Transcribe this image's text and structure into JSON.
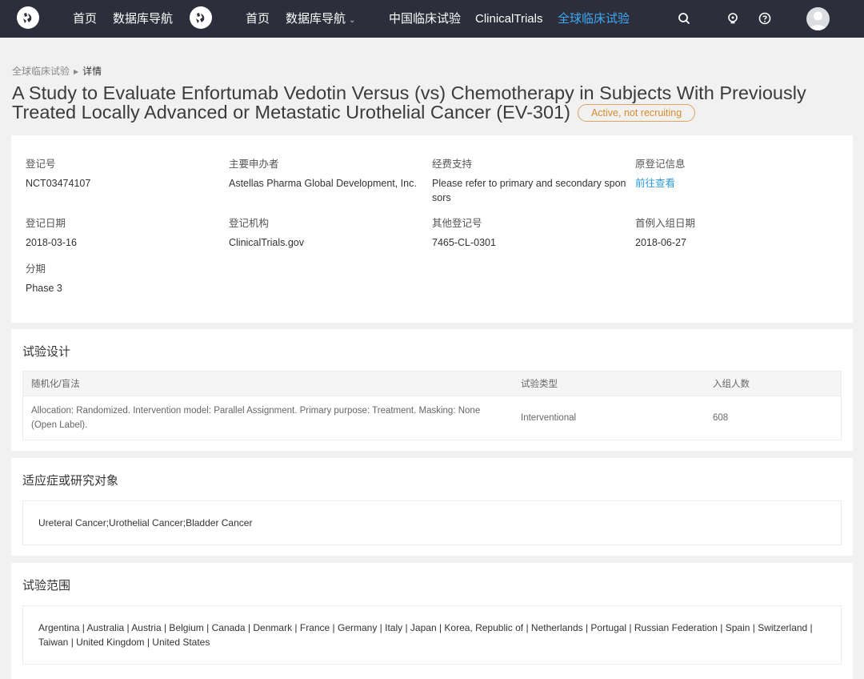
{
  "nav": {
    "home_1": "首页",
    "db_nav_1": "数据库导航",
    "home_2": "首页",
    "db_nav_2": "数据库导航",
    "cn_trials": "中国临床试验",
    "clinicaltrials": "ClinicalTrials",
    "global_trials": "全球临床试验",
    "icons": [
      "search-icon",
      "lightbulb-icon",
      "help-icon",
      "user-avatar"
    ],
    "accent_color": "#3fa9f5",
    "bg_color": "#2c2f3b"
  },
  "breadcrumb": {
    "parent": "全球临床试验",
    "current": "详情"
  },
  "trial": {
    "title": "A Study to Evaluate Enfortumab Vedotin Versus (vs) Chemotherapy in Subjects With Previously Treated Locally Advanced or Metastatic Urothelial Cancer (EV-301)",
    "status": "Active, not recruiting",
    "status_color": "#d88b2c"
  },
  "info": {
    "reg_no_label": "登记号",
    "reg_no": "NCT03474107",
    "sponsor_label": "主要申办者",
    "sponsor": "Astellas Pharma Global Development, Inc.",
    "funding_label": "经费支持",
    "funding": "Please refer to primary and secondary sponsors",
    "orig_label": "原登记信息",
    "orig_link": "前往查看",
    "reg_date_label": "登记日期",
    "reg_date": "2018-03-16",
    "reg_org_label": "登记机构",
    "reg_org": "ClinicalTrials.gov",
    "other_no_label": "其他登记号",
    "other_no": "7465-CL-0301",
    "first_enroll_label": "首例入组日期",
    "first_enroll": "2018-06-27",
    "phase_label": "分期",
    "phase": "Phase 3"
  },
  "design": {
    "section_title": "试验设计",
    "columns": [
      "随机化/盲法",
      "试验类型",
      "入组人数"
    ],
    "rows": [
      {
        "design": "Allocation: Randomized. Intervention model: Parallel Assignment. Primary purpose: Treatment. Masking: None (Open Label).",
        "type": "Interventional",
        "enrollment": "608"
      }
    ]
  },
  "conditions": {
    "section_title": "适应症或研究对象",
    "text": "Ureteral Cancer;Urothelial Cancer;Bladder Cancer"
  },
  "scope": {
    "section_title": "试验范围",
    "text": "Argentina | Australia | Austria | Belgium | Canada | Denmark | France | Germany | Italy | Japan | Korea, Republic of | Netherlands | Portugal | Russian Federation | Spain | Switzerland | Taiwan | United Kingdom | United States"
  }
}
